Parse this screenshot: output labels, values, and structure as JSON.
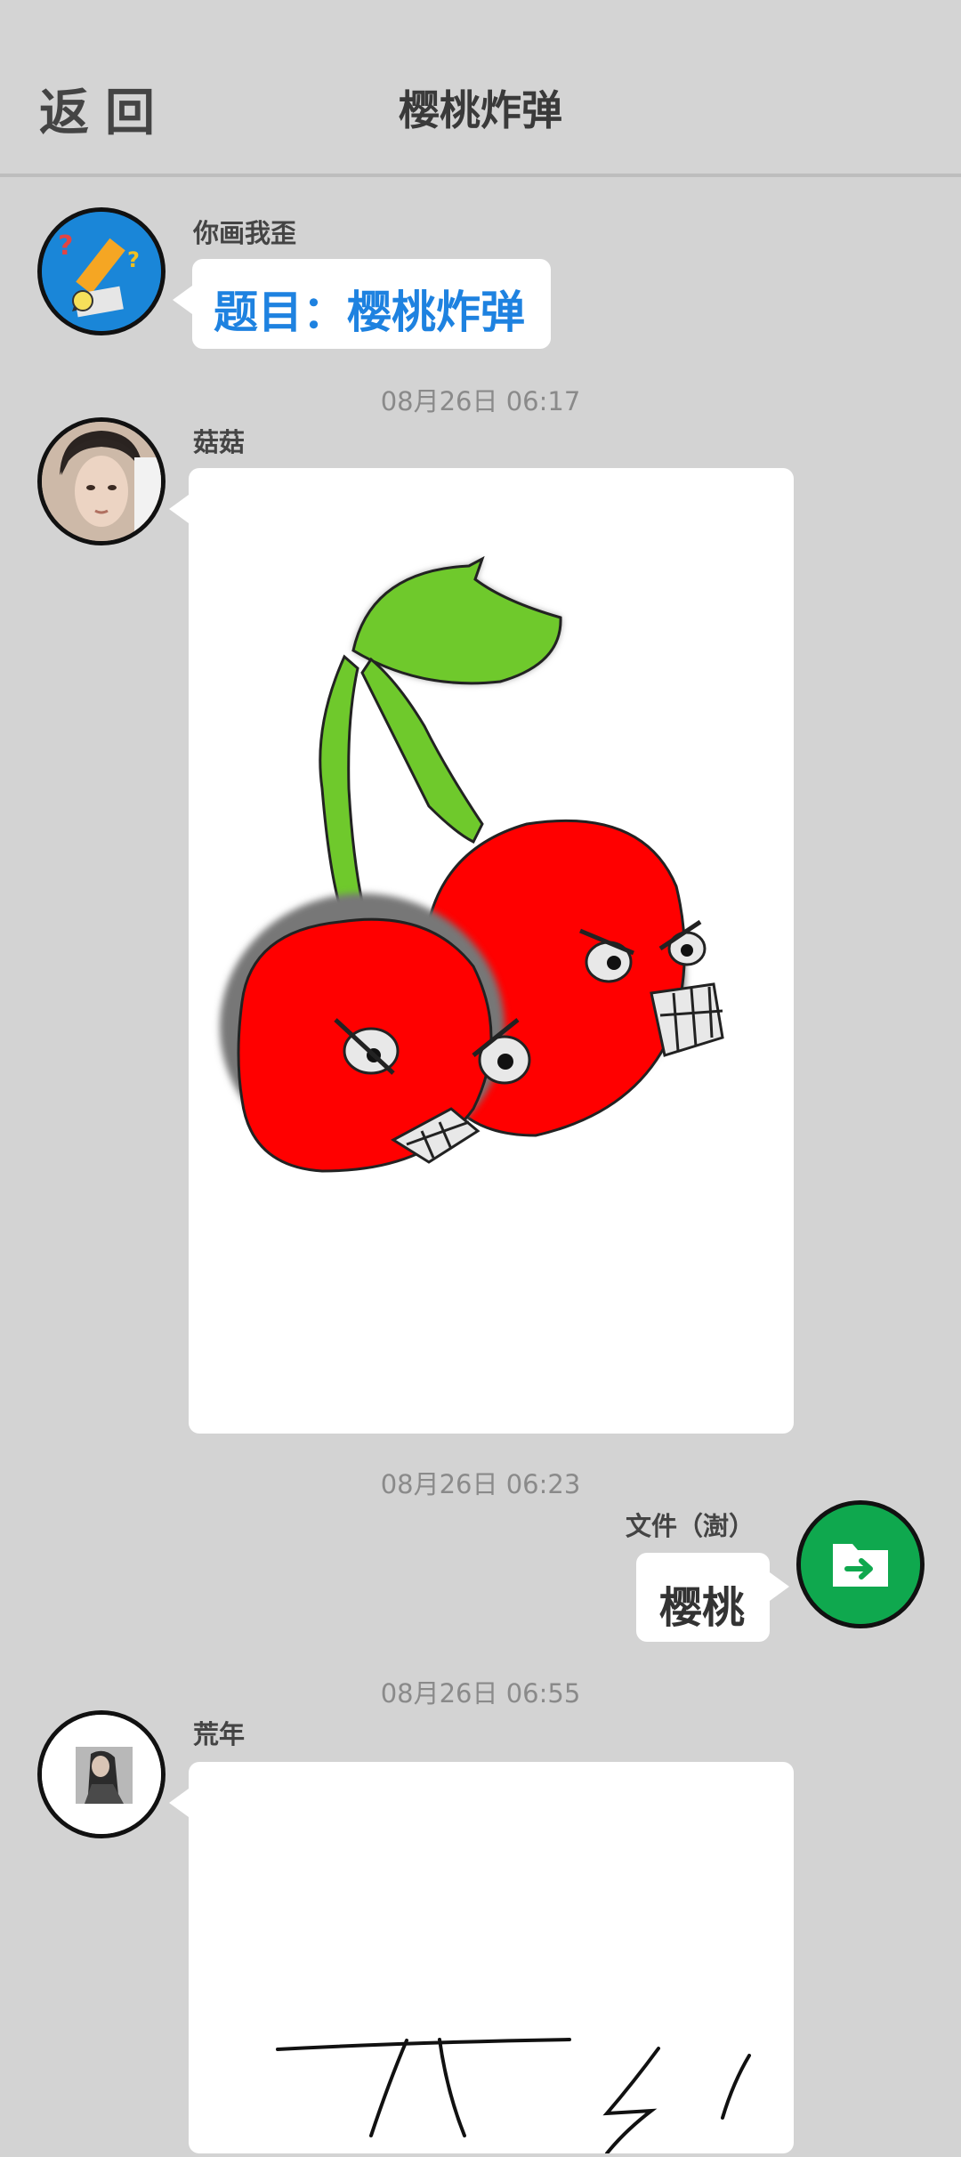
{
  "header": {
    "back_label": "返回",
    "title": "樱桃炸弹"
  },
  "messages": [
    {
      "sender": "你画我歪",
      "text": "题目：樱桃炸弹"
    },
    {
      "timestamp": "08月26日  06:17",
      "sender": "菇菇"
    },
    {
      "timestamp": "08月26日  06:23",
      "sender": "文件（澍）",
      "text": "樱桃"
    },
    {
      "timestamp": "08月26日  06:55",
      "sender": "荒年"
    }
  ],
  "colors": {
    "accent": "#1e82e0",
    "file_green": "#0fa84e",
    "cherry_red": "#ff0000",
    "leaf_green": "#6fc92c"
  }
}
